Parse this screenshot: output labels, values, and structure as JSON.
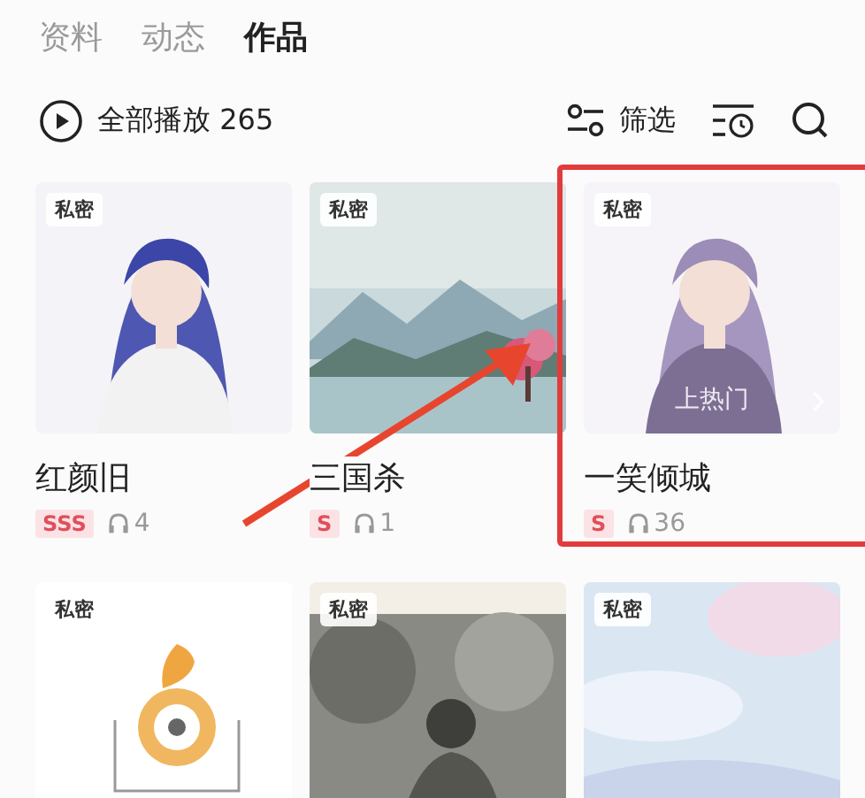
{
  "tabs": [
    {
      "label": "资料",
      "selected": false
    },
    {
      "label": "动态",
      "selected": false
    },
    {
      "label": "作品",
      "selected": true
    }
  ],
  "toolbar": {
    "play_all_label": "全部播放",
    "play_all_count": "265",
    "filter_label": "筛选"
  },
  "works": [
    {
      "private_tag": "私密",
      "title": "红颜旧",
      "grade": "SSS",
      "plays": "4",
      "highlighted": false
    },
    {
      "private_tag": "私密",
      "title": "三国杀",
      "grade": "S",
      "plays": "1",
      "highlighted": false
    },
    {
      "private_tag": "私密",
      "title": "一笑倾城",
      "grade": "S",
      "plays": "36",
      "trend_label": "上热门",
      "highlighted": true
    },
    {
      "private_tag": "私密",
      "highlighted": false
    },
    {
      "private_tag": "私密",
      "highlighted": false
    },
    {
      "private_tag": "私密",
      "highlighted": false
    }
  ],
  "annotation_arrow": true
}
